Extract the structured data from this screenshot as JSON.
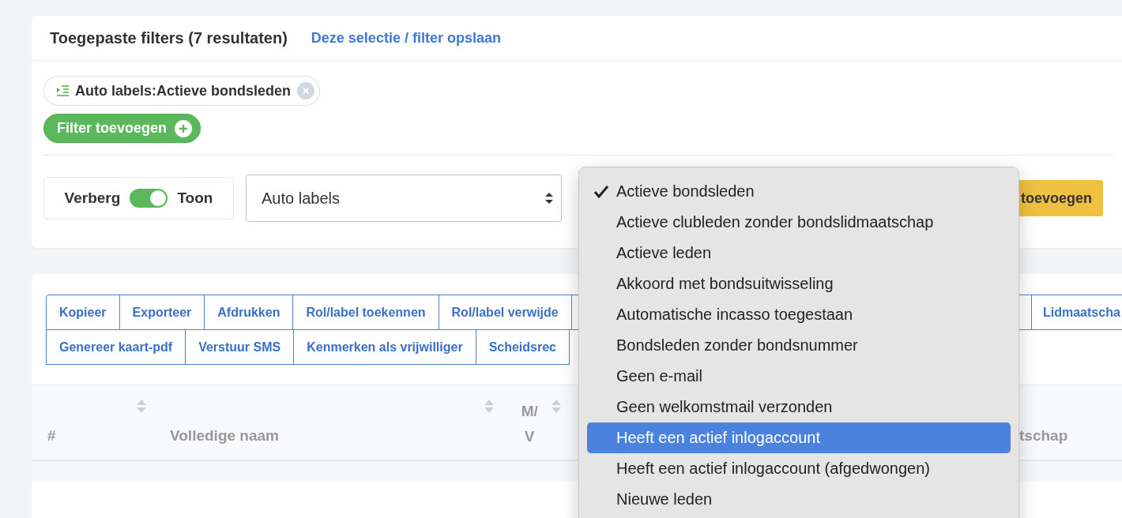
{
  "filters_panel": {
    "title": "Toegepaste filters (7 resultaten)",
    "save_link": "Deze selectie / filter opslaan",
    "chips": [
      {
        "label": "Auto labels:Actieve bondsleden"
      }
    ],
    "add_filter_button": "Filter toevoegen",
    "visibility_toggle": {
      "off_label": "Verberg",
      "on_label": "Toon",
      "on": true
    },
    "select": {
      "value": "Auto labels"
    },
    "add_button": "toevoegen"
  },
  "actions": {
    "row_1": [
      "Kopieer",
      "Exporteer",
      "Afdrukken",
      "Rol/label toekennen",
      "Rol/label verwijde"
    ],
    "row_1_right": "Lidmaatscha",
    "row_2": [
      "Genereer kaart-pdf",
      "Verstuur SMS",
      "Kenmerken als vrijwilliger",
      "Scheidsrec"
    ]
  },
  "table": {
    "columns": [
      {
        "label": "#",
        "sortable": true
      },
      {
        "label": "Volledige naam",
        "sortable": true
      },
      {
        "label": "M/V",
        "sortable": true
      }
    ],
    "column_last": "tschap"
  },
  "dropdown": {
    "options": [
      {
        "label": "Actieve bondsleden",
        "checked": true,
        "selected": false
      },
      {
        "label": "Actieve clubleden zonder bondslidmaatschap",
        "checked": false,
        "selected": false
      },
      {
        "label": "Actieve leden",
        "checked": false,
        "selected": false
      },
      {
        "label": "Akkoord met bondsuitwisseling",
        "checked": false,
        "selected": false
      },
      {
        "label": "Automatische incasso toegestaan",
        "checked": false,
        "selected": false
      },
      {
        "label": "Bondsleden zonder bondsnummer",
        "checked": false,
        "selected": false
      },
      {
        "label": "Geen e-mail",
        "checked": false,
        "selected": false
      },
      {
        "label": "Geen welkomstmail verzonden",
        "checked": false,
        "selected": false
      },
      {
        "label": "Heeft een actief inlogaccount",
        "checked": false,
        "selected": true
      },
      {
        "label": "Heeft een actief inlogaccount (afgedwongen)",
        "checked": false,
        "selected": false
      },
      {
        "label": "Nieuwe leden",
        "checked": false,
        "selected": false
      }
    ]
  }
}
